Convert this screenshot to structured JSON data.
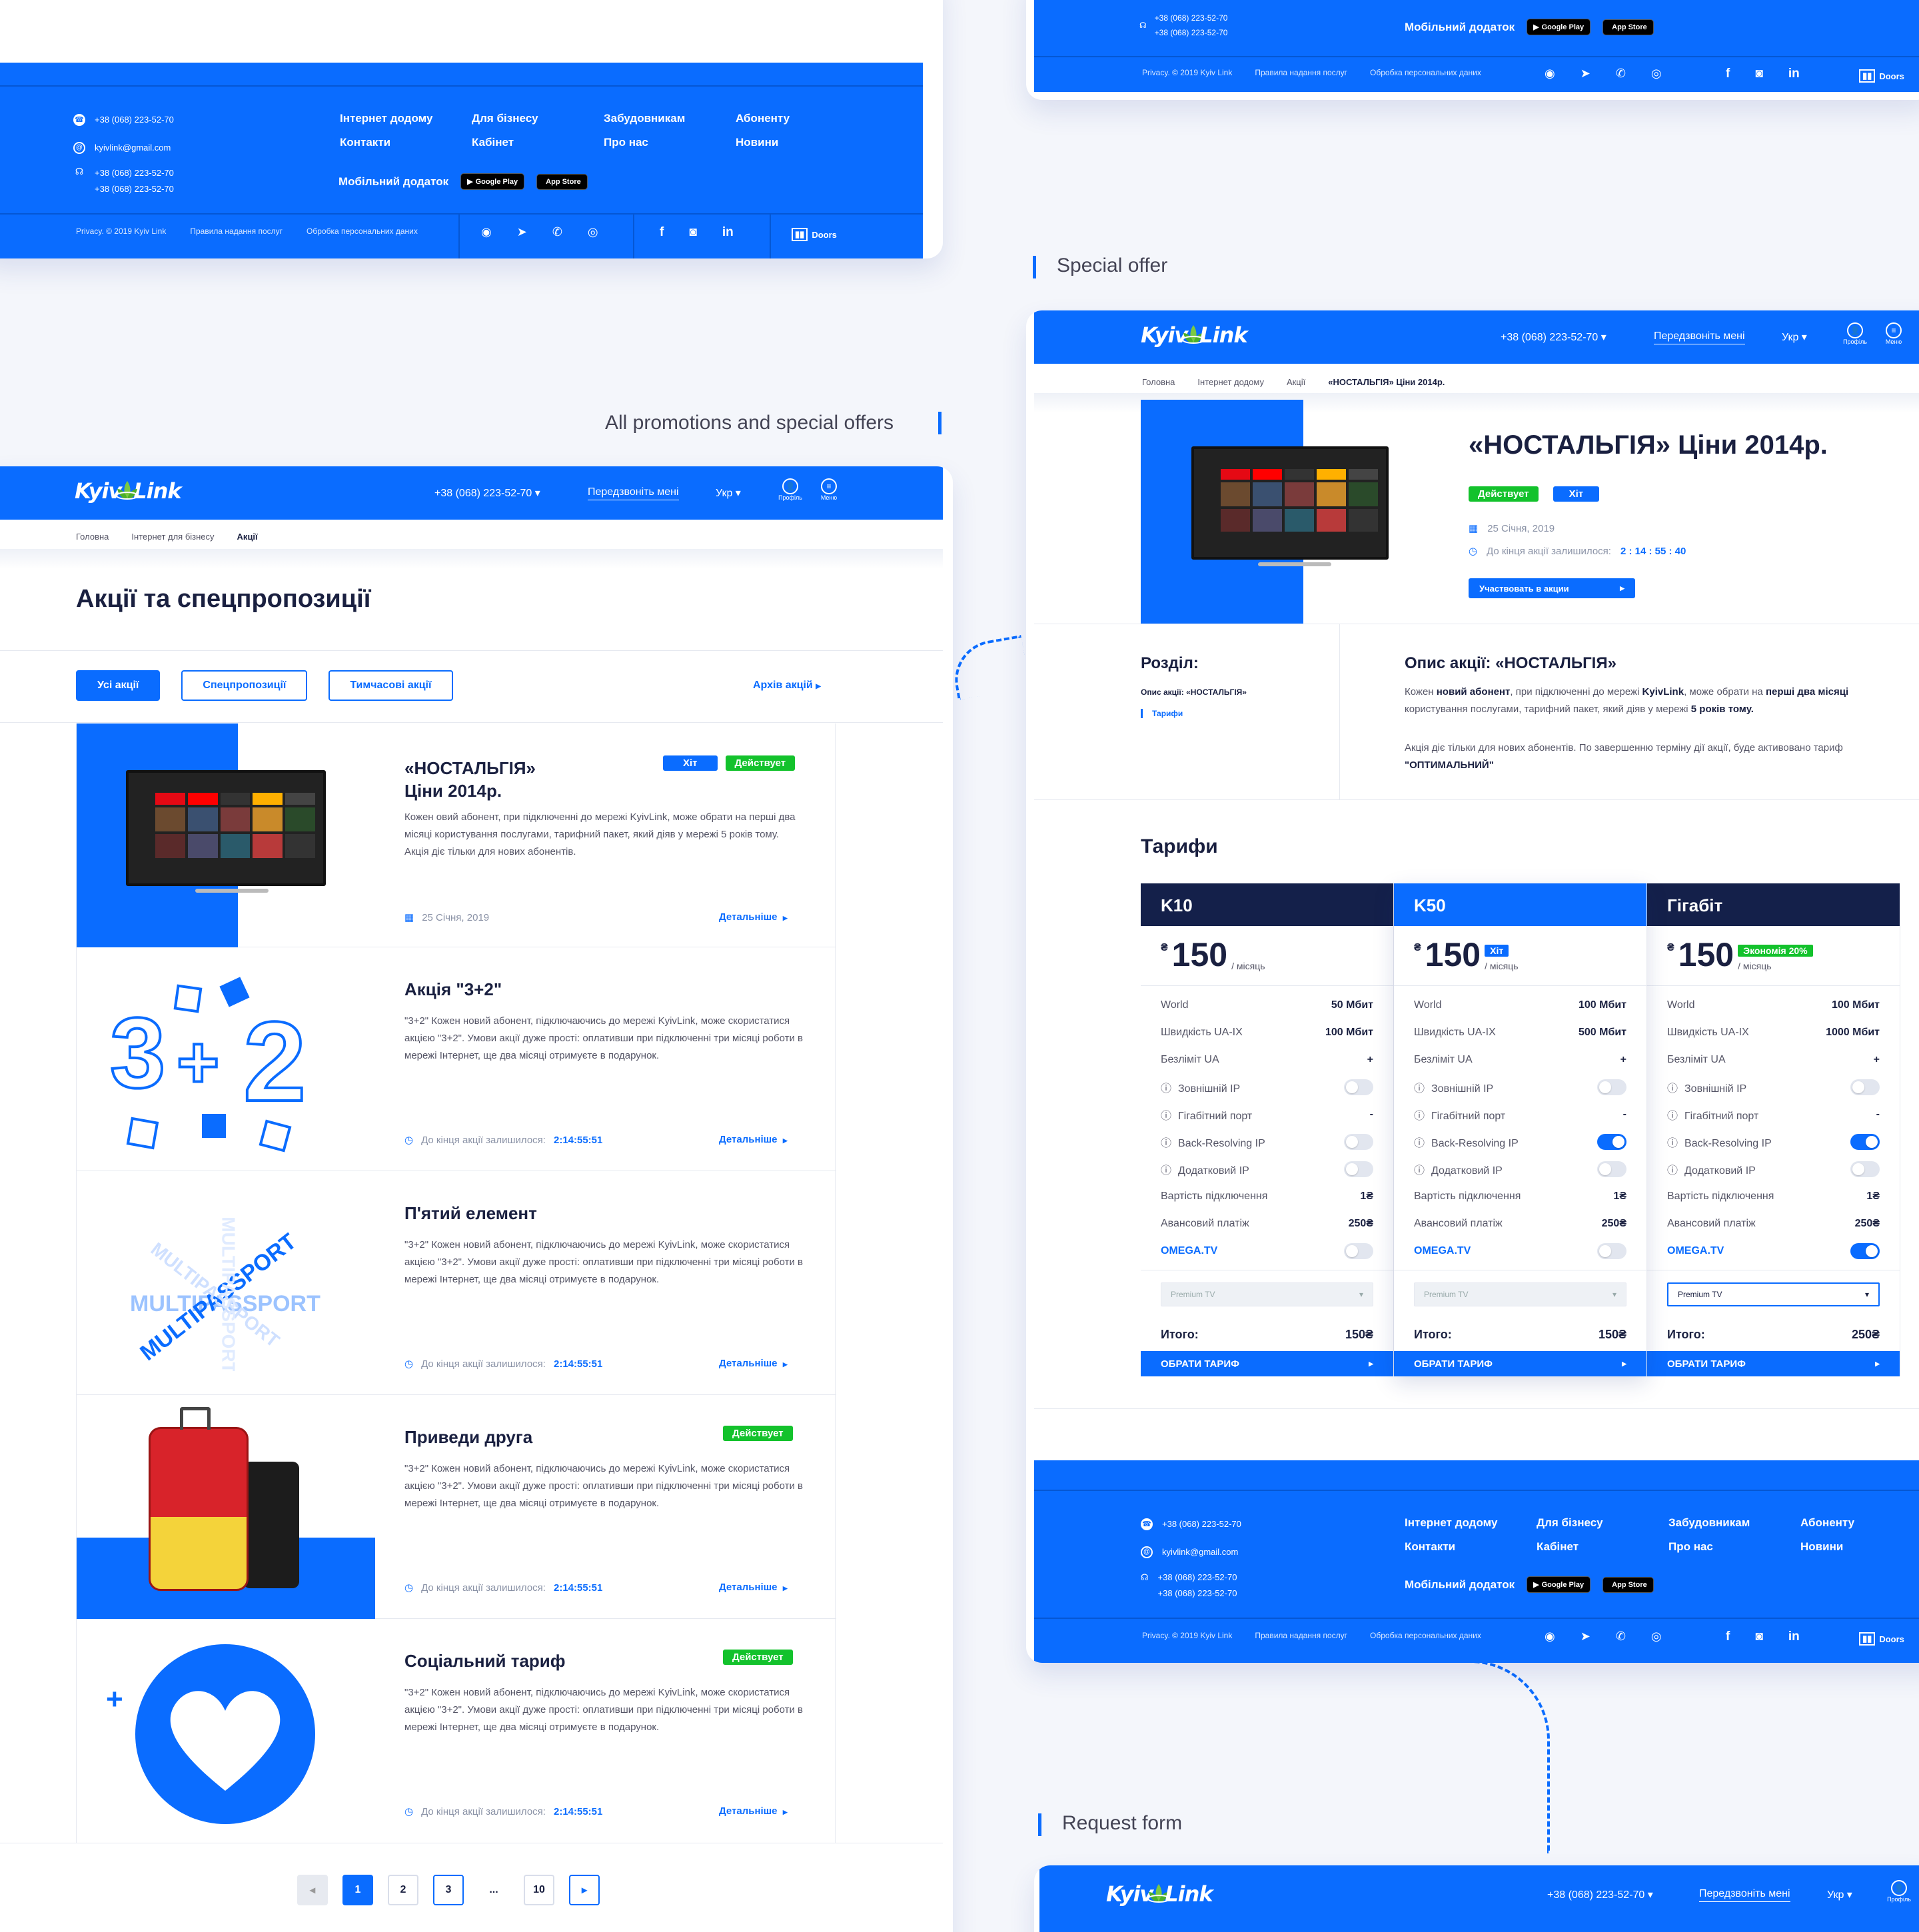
{
  "captions": {
    "special": "Special offer",
    "all": "All promotions and special offers",
    "request": "Request form"
  },
  "brand": {
    "name_left": "Kyiv",
    "name_right": "Link",
    "accent": "#0a6cff",
    "green": "#13c22c",
    "dark": "#14204a"
  },
  "header": {
    "phone": "+38 (068) 223-52-70",
    "callback": "Передзвоніть мені",
    "lang": "Укр",
    "profile": "Профіль",
    "menu": "Меню"
  },
  "footer": {
    "phone1": "+38 (068) 223-52-70",
    "email": "kyivlink@gmail.com",
    "phone2": "+38 (068) 223-52-70",
    "phone3": "+38 (068) 223-52-70",
    "links": [
      "Інтернет додому",
      "Для бізнесу",
      "Забудовникам",
      "Абоненту",
      "Контакти",
      "Кабінет",
      "Про нас",
      "Новини"
    ],
    "mobile_app": "Мобільний додаток",
    "google_top": "GET IT ON",
    "google": "Google Play",
    "apple_top": "Download on the",
    "apple": "App Store",
    "privacy": "Privacy. © 2019 Kyiv Link",
    "rules": "Правила надання послуг",
    "personal": "Обробка персональних даних",
    "doors": "Doors"
  },
  "list_page": {
    "breadcrumb": [
      "Головна",
      "Інтернет для бізнесу",
      "Акції"
    ],
    "title": "Акції та спецпропозиції",
    "filters": [
      "Усі акції",
      "Спецпропозиції",
      "Тимчасові акції"
    ],
    "archive": "Архів акцій",
    "more": "Детальніше",
    "countdown_label": "До кінця акції залишилося:",
    "countdown": "2:14:55:51",
    "items": [
      {
        "title1": "«НОСТАЛЬГІЯ»",
        "title2": "Ціни 2014р.",
        "badges": [
          "Хіт",
          "Действует"
        ],
        "text": "Кожен овий абонент, при підключенні до мережі KyivLink, може обрати на перші два місяці користування послугами, тарифний пакет, який діяв у мережі 5 років тому. Акція діє тільки для нових абонентів.",
        "date": "25 Січня, 2019"
      },
      {
        "title1": "Акція \"3+2\"",
        "text": "\"3+2\" Кожен новий абонент, підключаючись до мережі KyivLink, може скористатися акцією \"3+2\". Умови акції дуже прості: оплативши при підключенні три місяці роботи в мережі Інтернет, ще два місяці отримуєте в подарунок."
      },
      {
        "title1": "П'ятий елемент",
        "text": "\"3+2\" Кожен новий абонент, підключаючись до мережі KyivLink, може скористатися акцією \"3+2\". Умови акції дуже прості: оплативши при підключенні три місяці роботи в мережі Інтернет, ще два місяці отримуєте в подарунок."
      },
      {
        "title1": "Приведи друга",
        "badge": "Действует",
        "text": "\"3+2\" Кожен новий абонент, підключаючись до мережі KyivLink, може скористатися акцією \"3+2\". Умови акції дуже прості: оплативши при підключенні три місяці роботи в мережі Інтернет, ще два місяці отримуєте в подарунок."
      },
      {
        "title1": "Соціальний тариф",
        "badge": "Действует",
        "text": "\"3+2\" Кожен новий абонент, підключаючись до мережі KyivLink, може скористатися акцією \"3+2\". Умови акції дуже прості: оплативши при підключенні три місяці роботи в мережі Інтернет, ще два місяці отримуєте в подарунок."
      }
    ],
    "multipassport": "MULTIPASSPORT",
    "pages": [
      "1",
      "2",
      "3",
      "...",
      "10"
    ]
  },
  "offer_page": {
    "breadcrumb": [
      "Головна",
      "Інтернет додому",
      "Акції",
      "«НОСТАЛЬГІЯ» Ціни 2014р."
    ],
    "title": "«НОСТАЛЬГІЯ» Ціни 2014р.",
    "status": "Действует",
    "hit": "Хіт",
    "date": "25 Січня, 2019",
    "countdown_label": "До кінця акції залишилося:",
    "countdown": "2 : 14 : 55 : 40",
    "join": "Участвовать в акции",
    "section_title": "Розділ:",
    "section_item1": "Опис акції: «НОСТАЛЬГІЯ»",
    "section_item2": "Тарифи",
    "desc_title": "Опис акції: «НОСТАЛЬГІЯ»",
    "desc_p1_a": "Кожен ",
    "desc_p1_b": "новий абонент",
    "desc_p1_c": ", при підключенні до мережі ",
    "desc_p1_d": "KyivLink",
    "desc_p1_e": ", може обрати на ",
    "desc_p1_f": "перші два місяці",
    "desc_p1_g": " користування послугами, тарифний пакет, який діяв у мережі ",
    "desc_p1_h": "5 років тому.",
    "desc_p2": "Акція діє тільки для нових абонентів. По завершенню терміну дії акції, буде активовано тариф",
    "desc_p2_b": "\"ОПТИМАЛЬНИЙ\"",
    "tariffs_title": "Тарифи",
    "currency": "₴",
    "per_month": "/ місяць",
    "row_labels": [
      "World",
      "Швидкість UA-IX",
      "Безліміт UA",
      "Зовнішній IP",
      "Гігабітний порт",
      "Back-Resolving IP",
      "Додатковий IP",
      "Вартість підключення",
      "Авансовий платіж",
      "OMEGA.TV"
    ],
    "select_placeholder": "Premium TV",
    "total_label": "Итого:",
    "choose": "ОБРАТИ ТАРИФ",
    "plans": [
      {
        "name": "K10",
        "price": "150",
        "tag": "",
        "world": "50 Мбит",
        "uaix": "100 Мбит",
        "unlim": "+",
        "ext_ip": false,
        "giga": "-",
        "backres": false,
        "add_ip": false,
        "connect": "1₴",
        "advance": "250₴",
        "omega": false,
        "total": "150₴",
        "highlight": false
      },
      {
        "name": "K50",
        "price": "150",
        "tag": "Хіт",
        "world": "100 Мбит",
        "uaix": "500 Мбит",
        "unlim": "+",
        "ext_ip": false,
        "giga": "-",
        "backres": true,
        "add_ip": false,
        "connect": "1₴",
        "advance": "250₴",
        "omega": false,
        "total": "150₴",
        "highlight": true
      },
      {
        "name": "Гігабіт",
        "price": "150",
        "tag": "Экономія 20%",
        "world": "100 Мбит",
        "uaix": "1000 Мбит",
        "unlim": "+",
        "ext_ip": false,
        "giga": "-",
        "backres": true,
        "add_ip": false,
        "connect": "1₴",
        "advance": "250₴",
        "omega": true,
        "total": "250₴",
        "highlight": false
      }
    ]
  }
}
